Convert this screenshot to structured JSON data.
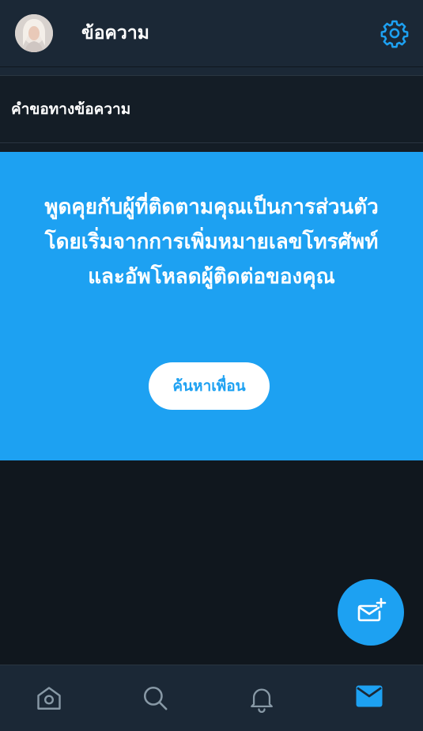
{
  "header": {
    "title": "ข้อความ",
    "settings_icon": "gear-icon",
    "avatar_icon": "avatar"
  },
  "requests": {
    "label": "คำขอทางข้อความ"
  },
  "promo": {
    "text": "พูดคุยกับผู้ที่ติดตามคุณเป็นการส่วนตัว โดยเริ่มจากการเพิ่มหมายเลขโทรศัพท์และอัพโหลดผู้ติดต่อของคุณ",
    "button_label": "ค้นหาเพื่อน"
  },
  "fab": {
    "icon": "new-message-icon"
  },
  "bottom_nav": {
    "items": [
      {
        "icon": "home-icon",
        "active": false
      },
      {
        "icon": "search-icon",
        "active": false
      },
      {
        "icon": "bell-icon",
        "active": false
      },
      {
        "icon": "mail-icon",
        "active": true
      }
    ]
  },
  "colors": {
    "accent": "#1da1f2",
    "header_bg": "#1b2836",
    "page_bg": "#141d26",
    "empty_bg": "#10171e",
    "icon_inactive": "#8899a6"
  }
}
